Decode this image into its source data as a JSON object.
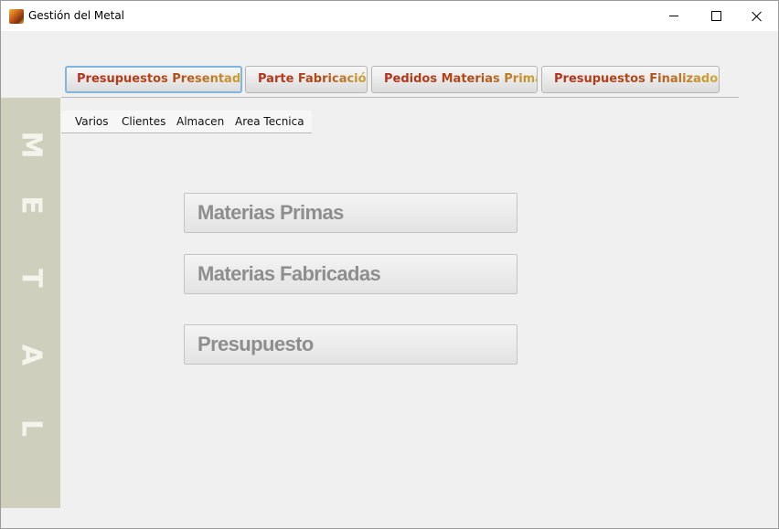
{
  "window": {
    "title": "Gestión del Metal",
    "icon": "app-metal-icon"
  },
  "tabs": [
    {
      "label": "Presupuestos Presentados",
      "active": true
    },
    {
      "label": "Parte Fabricación",
      "active": false
    },
    {
      "label": "Pedidos Materias Primas",
      "active": false
    },
    {
      "label": "Presupuestos Finalizados",
      "active": false
    }
  ],
  "menu": [
    "Varios",
    "Clientes",
    "Almacen",
    "Area Tecnica"
  ],
  "sidebar": {
    "letters": [
      "M",
      "E",
      "T",
      "A",
      "L"
    ]
  },
  "buttons": {
    "materias_primas": "Materias Primas",
    "materias_fabricadas": "Materias Fabricadas",
    "presupuesto": "Presupuesto"
  },
  "colors": {
    "tab_text_start": "#b5301a",
    "tab_text_end": "#d1b73b",
    "sidebar_bg": "#cfcfbe",
    "button_text": "#8e8e8e",
    "active_tab_border": "#7fb6e0"
  }
}
